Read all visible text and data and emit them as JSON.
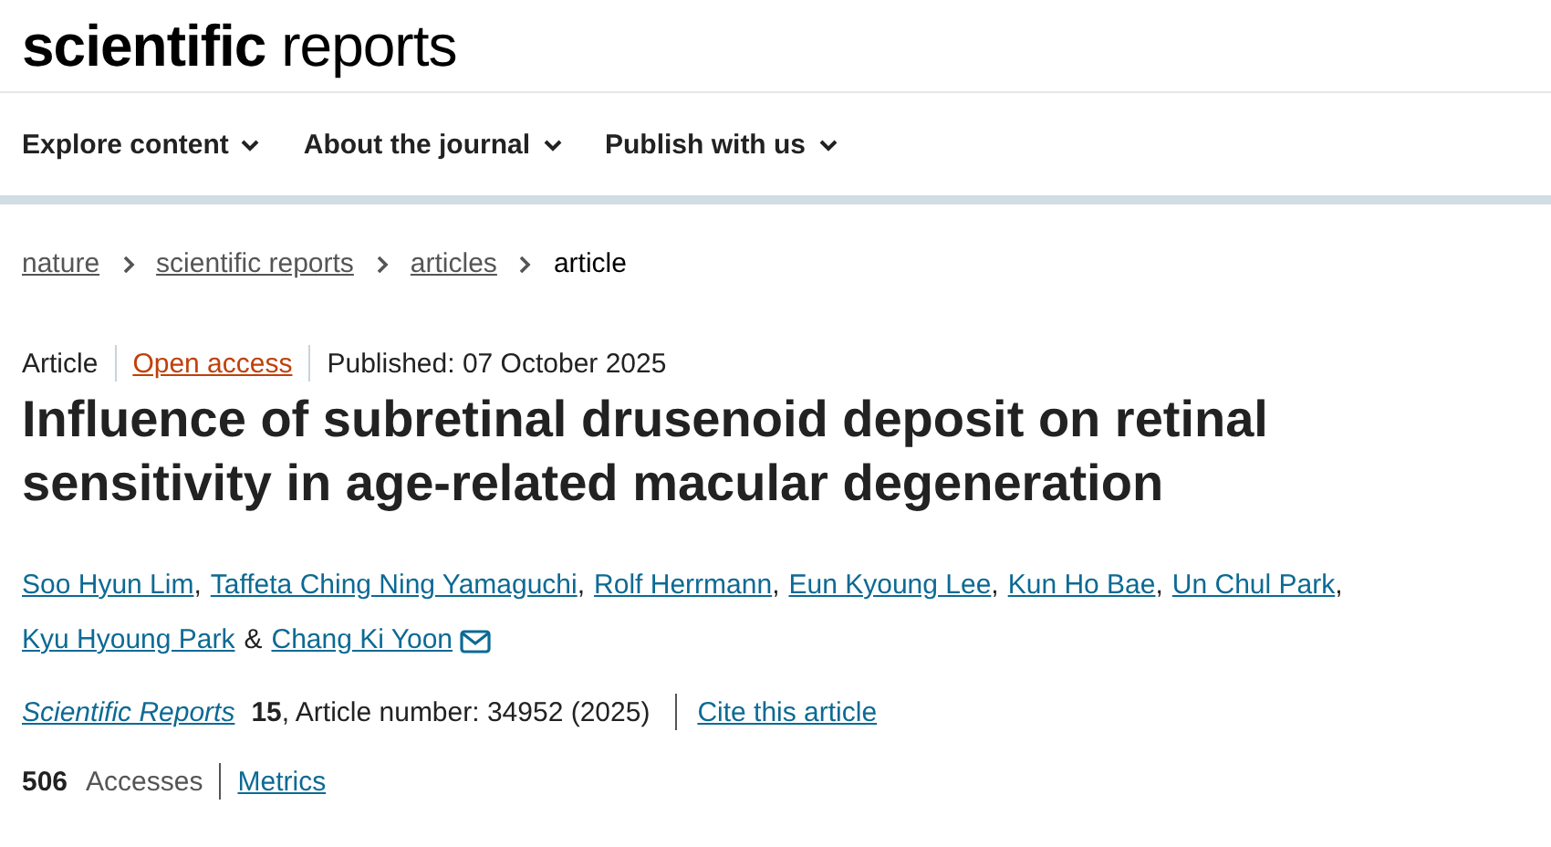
{
  "logo": "**scientific** reports",
  "nav": [
    {
      "label": "Explore content"
    },
    {
      "label": "About the journal"
    },
    {
      "label": "Publish with us"
    }
  ],
  "breadcrumbs": [
    {
      "label": "nature",
      "link": true
    },
    {
      "label": "scientific reports",
      "link": true
    },
    {
      "label": "articles",
      "link": true
    },
    {
      "label": "article",
      "link": false
    }
  ],
  "meta": {
    "type": "Article",
    "access": "Open access",
    "published": "Published: 07 October 2025"
  },
  "title": "Influence of subretinal drusenoid deposit on retinal sensitivity in age-related macular degeneration",
  "authors": [
    {
      "name": "Soo Hyun Lim",
      "separator": ","
    },
    {
      "name": "Taffeta Ching Ning Yamaguchi",
      "separator": ","
    },
    {
      "name": "Rolf Herrmann",
      "separator": ","
    },
    {
      "name": "Eun Kyoung Lee",
      "separator": ","
    },
    {
      "name": "Kun Ho Bae",
      "separator": ","
    },
    {
      "name": "Un Chul Park",
      "separator": ","
    },
    {
      "name": "Kyu Hyoung Park",
      "separator": "&"
    },
    {
      "name": "Chang Ki Yoon",
      "email": true
    }
  ],
  "citation": {
    "journal": "Scientific Reports",
    "volume": "15",
    "details": ", Article number: 34952 (2025)",
    "cite": "Cite this article"
  },
  "metrics": {
    "count": "506",
    "label": "Accesses",
    "link": "Metrics"
  }
}
